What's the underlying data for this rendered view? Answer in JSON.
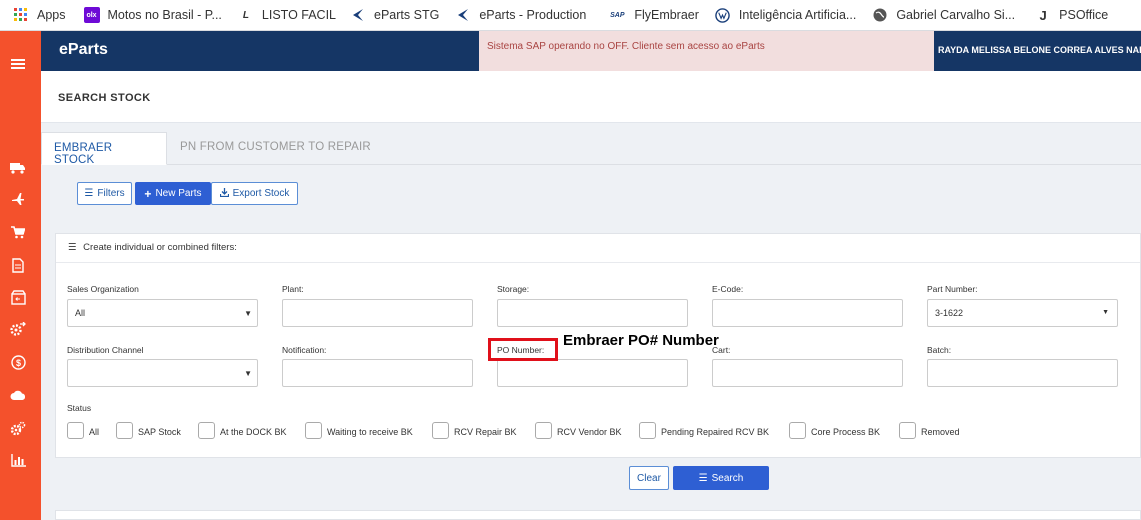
{
  "bookmarks": [
    {
      "label": "Apps",
      "icon": "apps-grid-icon"
    },
    {
      "label": "Motos no Brasil - P...",
      "icon": "olx-icon"
    },
    {
      "label": "LISTO FACIL",
      "icon": "listo-icon"
    },
    {
      "label": "eParts STG",
      "icon": "embraer-icon"
    },
    {
      "label": "eParts - Production",
      "icon": "embraer-icon"
    },
    {
      "label": "FlyEmbraer",
      "icon": "sap-icon"
    },
    {
      "label": "Inteligência Artificia...",
      "icon": "vw-icon"
    },
    {
      "label": "Gabriel Carvalho Si...",
      "icon": "globe-icon"
    },
    {
      "label": "PSOffice",
      "icon": "psoffice-icon"
    }
  ],
  "header": {
    "brand": "eParts",
    "alert": "Sistema SAP operando no OFF. Cliente sem acesso ao eParts",
    "user": "RAYDA MELISSA BELONE CORREA ALVES NAR"
  },
  "page": {
    "title": "SEARCH STOCK"
  },
  "tabs": [
    {
      "label": "EMBRAER STOCK",
      "active": true
    },
    {
      "label": "PN FROM CUSTOMER TO REPAIR",
      "active": false
    }
  ],
  "toolbar": {
    "filters": "Filters",
    "new_parts": "New Parts",
    "export_stock": "Export Stock"
  },
  "filters": {
    "header": "Create individual or combined filters:",
    "sales_org": {
      "label": "Sales Organization",
      "value": "All"
    },
    "plant": {
      "label": "Plant:",
      "value": ""
    },
    "storage": {
      "label": "Storage:",
      "value": ""
    },
    "ecode": {
      "label": "E-Code:",
      "value": ""
    },
    "part_number": {
      "label": "Part Number:",
      "value": "3-1622"
    },
    "dist_channel": {
      "label": "Distribution Channel",
      "value": ""
    },
    "notification": {
      "label": "Notification:",
      "value": ""
    },
    "po_number": {
      "label": "PO Number:",
      "value": ""
    },
    "cart": {
      "label": "Cart:",
      "value": ""
    },
    "batch": {
      "label": "Batch:",
      "value": ""
    },
    "status_label": "Status",
    "statuses": [
      "All",
      "SAP Stock",
      "At the DOCK BK",
      "Waiting to receive BK",
      "RCV Repair BK",
      "RCV Vendor BK",
      "Pending Repaired RCV BK",
      "Core Process BK",
      "Removed"
    ]
  },
  "actions": {
    "clear": "Clear",
    "search": "Search"
  },
  "annotation": {
    "text": "Embraer PO# Number",
    "color": "#e0101a"
  }
}
